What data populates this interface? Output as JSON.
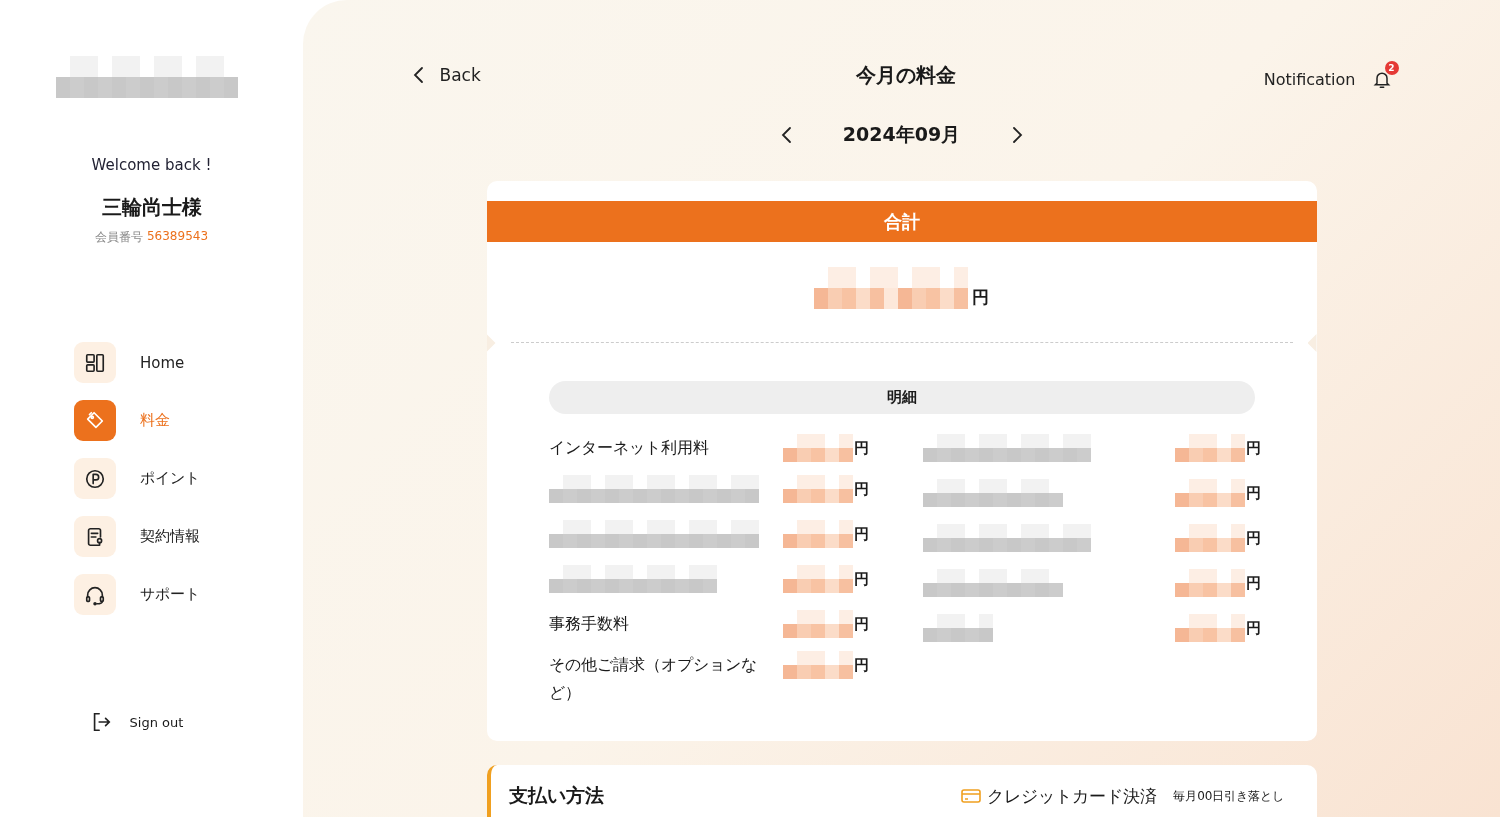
{
  "sidebar": {
    "logo": {
      "kind": "mosaic"
    },
    "welcome": "Welcome back !",
    "user_name": "三輪尚士様",
    "member_label": "会員番号",
    "member_number": "56389543",
    "items": [
      {
        "label": "Home",
        "selected": false
      },
      {
        "label": "料金",
        "selected": true
      },
      {
        "label": "ポイント",
        "selected": false
      },
      {
        "label": "契約情報",
        "selected": false
      },
      {
        "label": "サポート",
        "selected": false
      }
    ],
    "sign_out": "Sign out"
  },
  "header": {
    "back": "Back",
    "title": "今月の料金",
    "notification": "Notification",
    "badge": "2"
  },
  "month": {
    "label": "2024年09月"
  },
  "total": {
    "title": "合計",
    "unit": "円"
  },
  "details": {
    "title": "明細",
    "left": [
      {
        "kind": "text",
        "label": "インターネット利用料",
        "unit": "円"
      },
      {
        "kind": "mosaic",
        "unit": "円"
      },
      {
        "kind": "mosaic",
        "unit": "円"
      },
      {
        "kind": "mosaic",
        "unit": "円"
      },
      {
        "kind": "text",
        "label": "事務手数料",
        "unit": "円"
      },
      {
        "kind": "text",
        "label": "その他ご請求（オプションなど）",
        "unit": "円"
      }
    ],
    "right": [
      {
        "kind": "mosaic",
        "unit": "円"
      },
      {
        "kind": "mosaic",
        "unit": "円"
      },
      {
        "kind": "mosaic",
        "unit": "円"
      },
      {
        "kind": "mosaic",
        "unit": "円"
      },
      {
        "kind": "mosaic",
        "unit": "円"
      }
    ]
  },
  "payment": {
    "title": "支払い方法",
    "method": "クレジットカード決済",
    "note": "毎月00日引き落とし"
  }
}
